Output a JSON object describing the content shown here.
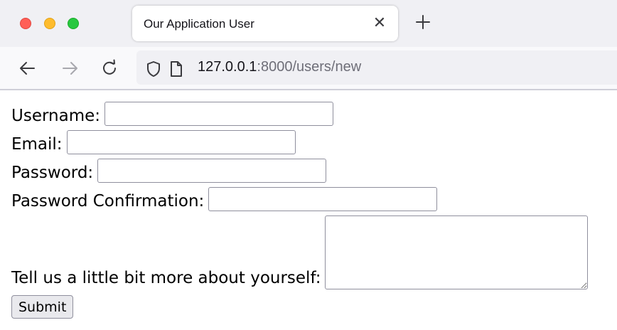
{
  "browser": {
    "tab": {
      "title": "Our Application User",
      "close_glyph": "✕"
    },
    "url": {
      "host": "127.0.0.1",
      "rest": ":8000/users/new"
    },
    "icons": {
      "back": "arrow-left-icon",
      "forward": "arrow-right-icon",
      "reload": "reload-icon",
      "shield": "shield-icon",
      "page": "page-icon",
      "new_tab": "plus-icon"
    },
    "colors": {
      "tabstrip": "#f0f0f4",
      "close": "#ff5f57",
      "minimize": "#febc2e",
      "maximize": "#28c840"
    }
  },
  "form": {
    "username_label": "Username:",
    "username_value": "",
    "email_label": "Email:",
    "email_value": "",
    "password_label": "Password:",
    "password_value": "",
    "password_confirmation_label": "Password Confirmation:",
    "password_confirmation_value": "",
    "about_label": "Tell us a little bit more about yourself:",
    "about_value": "",
    "submit_label": "Submit"
  }
}
